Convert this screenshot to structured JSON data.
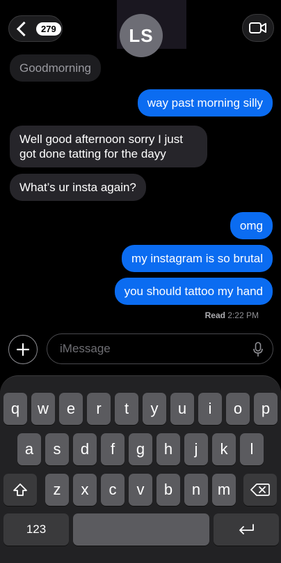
{
  "header": {
    "back_badge": "279",
    "contact_initials": "LS",
    "video_icon": "video-camera-icon"
  },
  "messages": [
    {
      "dir": "in",
      "text": "Goodmorning",
      "faded": true
    },
    {
      "dir": "out",
      "text": "way past morning silly"
    },
    {
      "dir": "in",
      "text": "Well good afternoon sorry I just got done tatting for the dayy"
    },
    {
      "dir": "in",
      "text": "What’s ur insta again?"
    },
    {
      "dir": "out",
      "text": "omg"
    },
    {
      "dir": "out",
      "text": "my instagram is so brutal"
    },
    {
      "dir": "out",
      "text": "you should tattoo my hand"
    }
  ],
  "read_receipt": {
    "label": "Read",
    "time": "2:22 PM"
  },
  "composer": {
    "placeholder": "iMessage"
  },
  "keyboard": {
    "row1": [
      "q",
      "w",
      "e",
      "r",
      "t",
      "y",
      "u",
      "i",
      "o",
      "p"
    ],
    "row2": [
      "a",
      "s",
      "d",
      "f",
      "g",
      "h",
      "j",
      "k",
      "l"
    ],
    "row3": [
      "z",
      "x",
      "c",
      "v",
      "b",
      "n",
      "m"
    ],
    "numbers_label": "123"
  },
  "colors": {
    "outgoing": "#0b6cf1",
    "incoming": "#26252a"
  }
}
